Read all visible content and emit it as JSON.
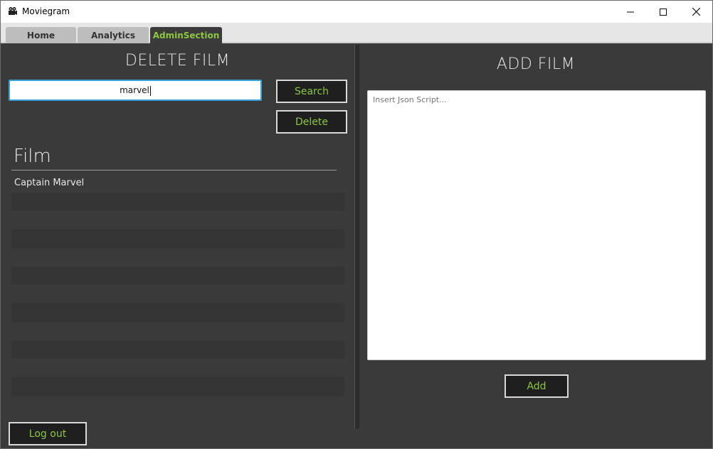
{
  "window": {
    "title": "Moviegram",
    "controls": {
      "minimize_icon": "minimize-icon",
      "maximize_icon": "maximize-icon",
      "close_icon": "close-icon"
    }
  },
  "tabs": [
    {
      "label": "Home",
      "active": false
    },
    {
      "label": "Analytics",
      "active": false
    },
    {
      "label": "AdminSection",
      "active": true
    }
  ],
  "delete_section": {
    "heading": "DELETE FILM",
    "search_value": "marvel",
    "search_button": "Search",
    "delete_button": "Delete",
    "list_header": "Film",
    "rows": [
      "Captain Marvel",
      "",
      "",
      "",
      "",
      "",
      "",
      "",
      "",
      "",
      "",
      "",
      ""
    ]
  },
  "add_section": {
    "heading": "ADD FILM",
    "json_placeholder": "Insert Json Script...",
    "add_button": "Add"
  },
  "footer": {
    "logout_button": "Log out"
  },
  "colors": {
    "accent": "#8dc63f",
    "background": "#3a3a3a",
    "focus_border": "#3aa0d8"
  }
}
